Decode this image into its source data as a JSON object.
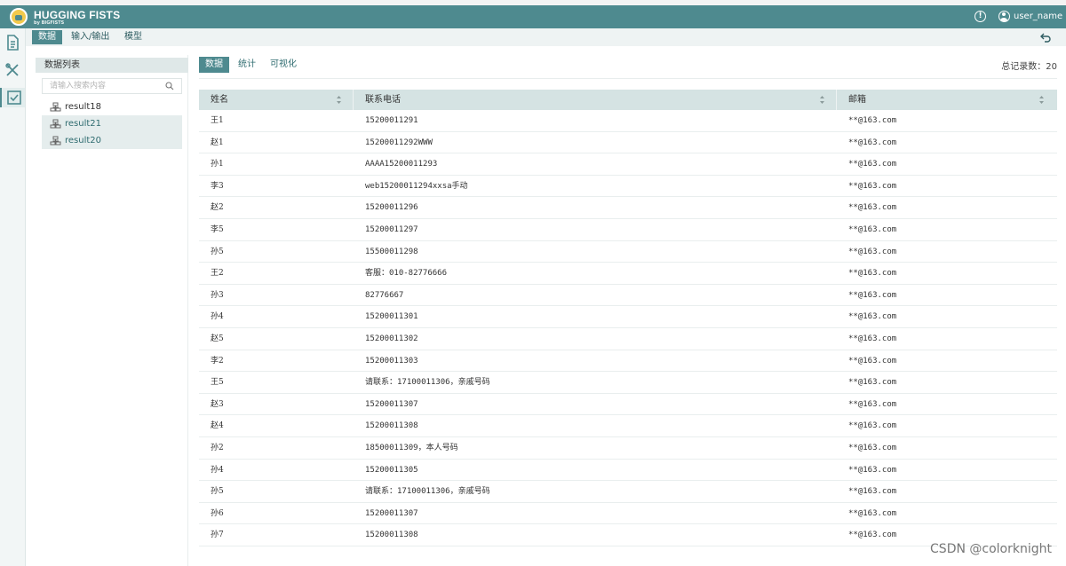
{
  "app": {
    "brand": "HUGGING FISTS",
    "brand_sub": "by BIGFISTS",
    "user_name": "user_name"
  },
  "nav": {
    "tabs": [
      {
        "label": "数据"
      },
      {
        "label": "输入/输出"
      },
      {
        "label": "模型"
      }
    ],
    "active_index": 0
  },
  "side": {
    "title": "数据列表",
    "search_placeholder": "请输入搜索内容",
    "items": [
      {
        "label": "result18"
      },
      {
        "label": "result21"
      },
      {
        "label": "result20"
      }
    ]
  },
  "main": {
    "tabs": [
      {
        "label": "数据"
      },
      {
        "label": "统计"
      },
      {
        "label": "可视化"
      }
    ],
    "active_index": 0,
    "total_label": "总记录数：",
    "total_value": "20"
  },
  "table": {
    "headers": [
      "姓名",
      "联系电话",
      "邮箱"
    ],
    "rows": [
      [
        "王1",
        "15200011291",
        "**@163.com"
      ],
      [
        "赵1",
        "15200011292WWW",
        "**@163.com"
      ],
      [
        "孙1",
        "AAAA15200011293",
        "**@163.com"
      ],
      [
        "李3",
        "web15200011294xxsa手动",
        "**@163.com"
      ],
      [
        "赵2",
        "15200011296",
        "**@163.com"
      ],
      [
        "李5",
        "15200011297",
        "**@163.com"
      ],
      [
        "孙5",
        "15500011298",
        "**@163.com"
      ],
      [
        "王2",
        "客服：010-82776666",
        "**@163.com"
      ],
      [
        "孙3",
        "82776667",
        "**@163.com"
      ],
      [
        "孙4",
        "15200011301",
        "**@163.com"
      ],
      [
        "赵5",
        "15200011302",
        "**@163.com"
      ],
      [
        "李2",
        "15200011303",
        "**@163.com"
      ],
      [
        "王5",
        "请联系：17100011306，亲戚号码",
        "**@163.com"
      ],
      [
        "赵3",
        "15200011307",
        "**@163.com"
      ],
      [
        "赵4",
        "15200011308",
        "**@163.com"
      ],
      [
        "孙2",
        "18500011309，本人号码",
        "**@163.com"
      ],
      [
        "孙4",
        "15200011305",
        "**@163.com"
      ],
      [
        "孙5",
        "请联系：17100011306，亲戚号码",
        "**@163.com"
      ],
      [
        "孙6",
        "15200011307",
        "**@163.com"
      ],
      [
        "孙7",
        "15200011308",
        "**@163.com"
      ]
    ]
  },
  "watermark": "CSDN @colorknight",
  "colors": {
    "brand": "#4e8a8f",
    "header_row": "#d5e3e3",
    "selected": "#e5eded"
  },
  "icons": [
    "info-icon",
    "user-icon",
    "document-icon",
    "tools-icon",
    "check-icon",
    "back-icon",
    "search-icon",
    "database-icon",
    "sort-icon"
  ]
}
